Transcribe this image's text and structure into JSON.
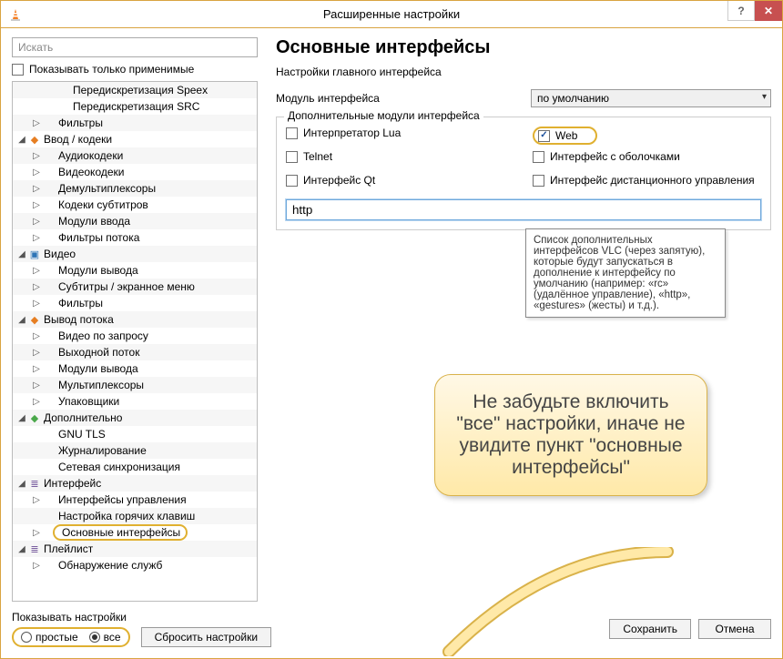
{
  "window": {
    "title": "Расширенные настройки",
    "help": "?",
    "close": "✕"
  },
  "search": {
    "placeholder": "Искать"
  },
  "only_applicable_label": "Показывать только применимые",
  "tree": [
    {
      "d": 2,
      "t": "",
      "i": "",
      "l": "Передискретизация Speex"
    },
    {
      "d": 2,
      "t": "",
      "i": "",
      "l": "Передискретизация SRC"
    },
    {
      "d": 1,
      "t": "closed",
      "i": "",
      "l": "Фильтры"
    },
    {
      "d": 0,
      "t": "open",
      "i": "orange",
      "l": "Ввод / кодеки"
    },
    {
      "d": 1,
      "t": "closed",
      "i": "",
      "l": "Аудиокодеки"
    },
    {
      "d": 1,
      "t": "closed",
      "i": "",
      "l": "Видеокодеки"
    },
    {
      "d": 1,
      "t": "closed",
      "i": "",
      "l": "Демультиплексоры"
    },
    {
      "d": 1,
      "t": "closed",
      "i": "",
      "l": "Кодеки субтитров"
    },
    {
      "d": 1,
      "t": "closed",
      "i": "",
      "l": "Модули ввода"
    },
    {
      "d": 1,
      "t": "closed",
      "i": "",
      "l": "Фильтры потока"
    },
    {
      "d": 0,
      "t": "open",
      "i": "blue",
      "l": "Видео"
    },
    {
      "d": 1,
      "t": "closed",
      "i": "",
      "l": "Модули вывода"
    },
    {
      "d": 1,
      "t": "closed",
      "i": "",
      "l": "Субтитры / экранное меню"
    },
    {
      "d": 1,
      "t": "closed",
      "i": "",
      "l": "Фильтры"
    },
    {
      "d": 0,
      "t": "open",
      "i": "orange",
      "l": "Вывод потока"
    },
    {
      "d": 1,
      "t": "closed",
      "i": "",
      "l": "Видео по запросу"
    },
    {
      "d": 1,
      "t": "closed",
      "i": "",
      "l": "Выходной поток"
    },
    {
      "d": 1,
      "t": "closed",
      "i": "",
      "l": "Модули вывода"
    },
    {
      "d": 1,
      "t": "closed",
      "i": "",
      "l": "Мультиплексоры"
    },
    {
      "d": 1,
      "t": "closed",
      "i": "",
      "l": "Упаковщики"
    },
    {
      "d": 0,
      "t": "open",
      "i": "green",
      "l": "Дополнительно"
    },
    {
      "d": 1,
      "t": "",
      "i": "",
      "l": "GNU TLS"
    },
    {
      "d": 1,
      "t": "",
      "i": "",
      "l": "Журналирование"
    },
    {
      "d": 1,
      "t": "",
      "i": "",
      "l": "Сетевая синхронизация"
    },
    {
      "d": 0,
      "t": "open",
      "i": "purple",
      "l": "Интерфейс"
    },
    {
      "d": 1,
      "t": "closed",
      "i": "",
      "l": "Интерфейсы управления"
    },
    {
      "d": 1,
      "t": "",
      "i": "",
      "l": "Настройка горячих клавиш"
    },
    {
      "d": 1,
      "t": "closed",
      "i": "",
      "l": "Основные интерфейсы",
      "hl": true
    },
    {
      "d": 0,
      "t": "open",
      "i": "purple",
      "l": "Плейлист"
    },
    {
      "d": 1,
      "t": "closed",
      "i": "",
      "l": "Обнаружение служб"
    }
  ],
  "right": {
    "heading": "Основные интерфейсы",
    "subheading": "Настройки главного интерфейса",
    "module_label": "Модуль интерфейса",
    "module_value": "по умолчанию",
    "group_label": "Дополнительные модули интерфейса",
    "chk_lua": "Интерпретатор Lua",
    "chk_web": "Web",
    "chk_telnet": "Telnet",
    "chk_skins": "Интерфейс с оболочками",
    "chk_qt": "Интерфейс Qt",
    "chk_rc": "Интерфейс дистанционного управления",
    "input_value": "http"
  },
  "tooltip": "Список дополнительных интерфейсов VLC (через запятую), которые будут запускаться в дополнение к интерфейсу по умолчанию (например: «rc» (удалённое управление), «http», «gestures» (жесты) и т.д.).",
  "callout": "Не забудьте включить \"все\" настройки, иначе не увидите пункт \"основные интерфейсы\"",
  "bottom": {
    "show_label": "Показывать настройки",
    "radio_simple": "простые",
    "radio_all": "все",
    "reset": "Сбросить настройки",
    "save": "Сохранить",
    "cancel": "Отмена"
  }
}
